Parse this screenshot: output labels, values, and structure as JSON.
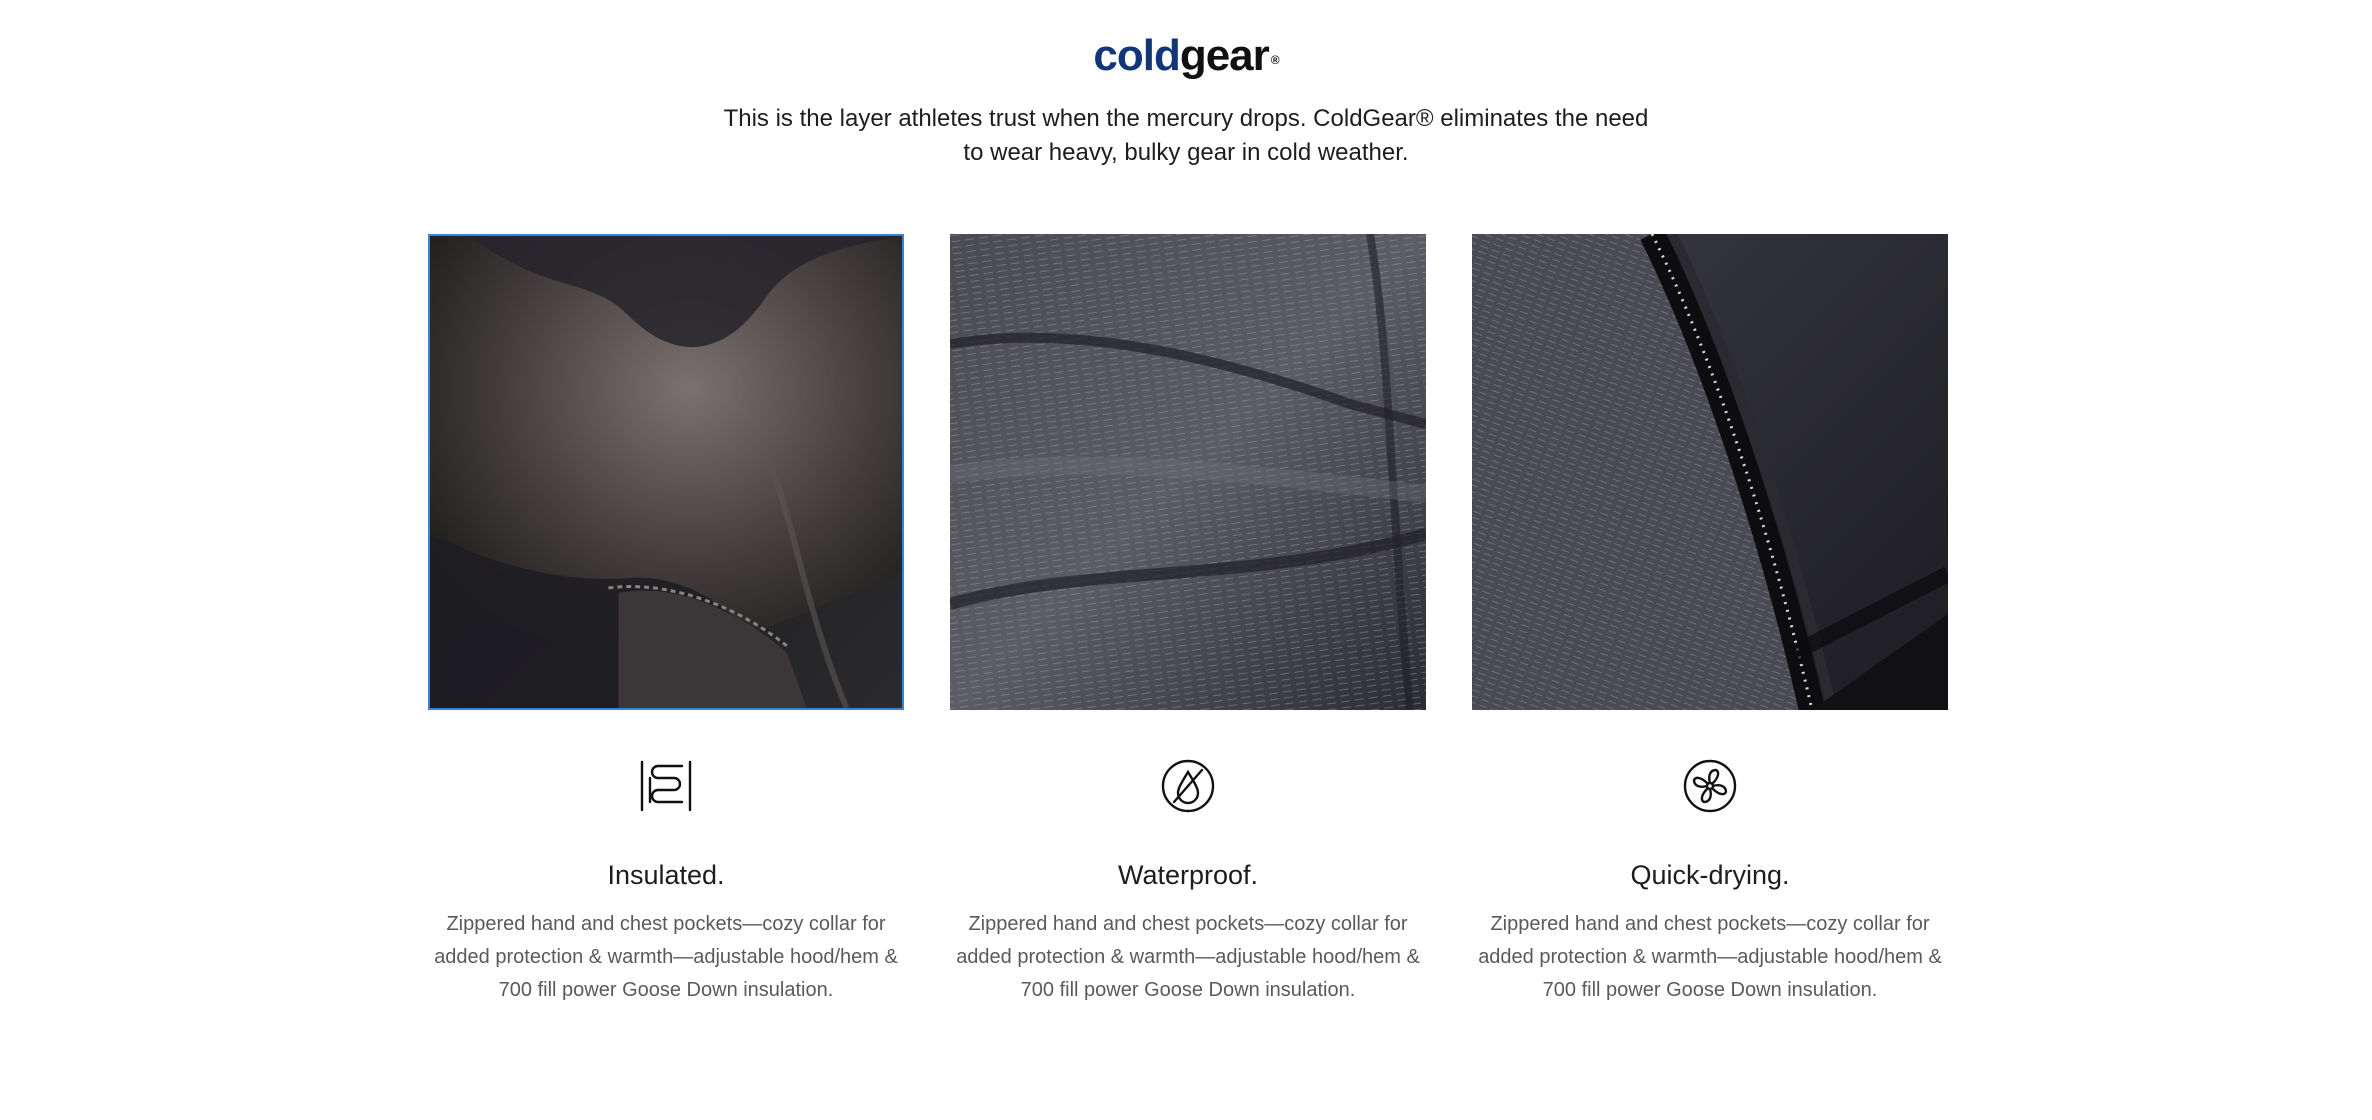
{
  "brand": {
    "logo_part1": "cold",
    "logo_part2": "gear",
    "logo_mark": "®",
    "colors": {
      "cold": "#13357a",
      "gear": "#111111"
    }
  },
  "intro": {
    "tagline": "This is the layer athletes trust when the mercury drops. ColdGear® eliminates the need to wear heavy, bulky gear in cold weather."
  },
  "features": [
    {
      "icon": "insulation-coil-icon",
      "image": "fleece-lining-photo",
      "selected": true,
      "title": "Insulated.",
      "description": "Zippered hand and chest pockets—cozy collar for added protection & warmth—adjustable hood/hem & 700 fill power Goose Down insulation."
    },
    {
      "icon": "waterproof-drop-icon",
      "image": "quilted-shell-photo",
      "selected": false,
      "title": "Waterproof.",
      "description": "Zippered hand and chest pockets—cozy collar for added protection & warmth—adjustable hood/hem & 700 fill power Goose Down insulation."
    },
    {
      "icon": "quick-dry-fan-icon",
      "image": "zipper-detail-photo",
      "selected": false,
      "title": "Quick-drying.",
      "description": "Zippered hand and chest pockets—cozy collar for added protection & warmth—adjustable hood/hem & 700 fill power Goose Down insulation."
    }
  ],
  "accent_color": "#3b82d6"
}
